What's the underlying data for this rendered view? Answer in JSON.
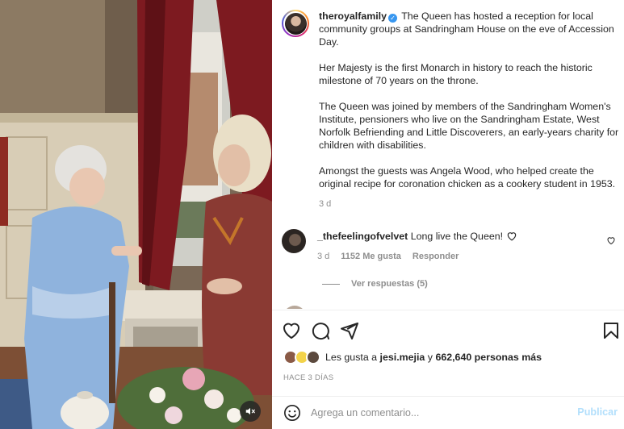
{
  "post": {
    "username": "theroyalfamily",
    "verified_icon": "verified-badge-icon",
    "caption_first": "The Queen has hosted a reception for local community groups at Sandringham House on the eve of Accession Day.",
    "caption_paragraphs": [
      "Her Majesty is the first Monarch in history to reach the historic milestone of 70 years on the throne.",
      "The Queen was joined by members of the Sandringham Women's Institute, pensioners who live on the Sandringham Estate, West Norfolk Befriending and Little Discoverers, an early-years charity for children with disabilities.",
      "Amongst the guests was Angela Wood, who helped create the original recipe for coronation chicken as a cookery student in 1953."
    ],
    "time_ago": "3 d"
  },
  "comment": {
    "username": "_thefeelingofvelvet",
    "text": "Long live the Queen!",
    "time_ago": "3 d",
    "likes": "1152 Me gusta",
    "reply_label": "Responder",
    "view_replies": "Ver respuestas (5)"
  },
  "likes": {
    "prefix": "Les gusta a",
    "user": "jesi.mejia",
    "middle": "y",
    "count": "662,640 personas más"
  },
  "posted_ago": "HACE 3 DÍAS",
  "compose": {
    "placeholder": "Agrega un comentario...",
    "publish_label": "Publicar"
  },
  "icons": {
    "like": "heart-icon",
    "comment": "comment-icon",
    "share": "share-icon",
    "save": "bookmark-icon",
    "emoji": "emoji-icon",
    "mute": "speaker-muted-icon"
  },
  "colors": {
    "verified": "#3897f0",
    "publish_disabled": "#b2dffc",
    "muted_text": "#8e8e8e"
  }
}
